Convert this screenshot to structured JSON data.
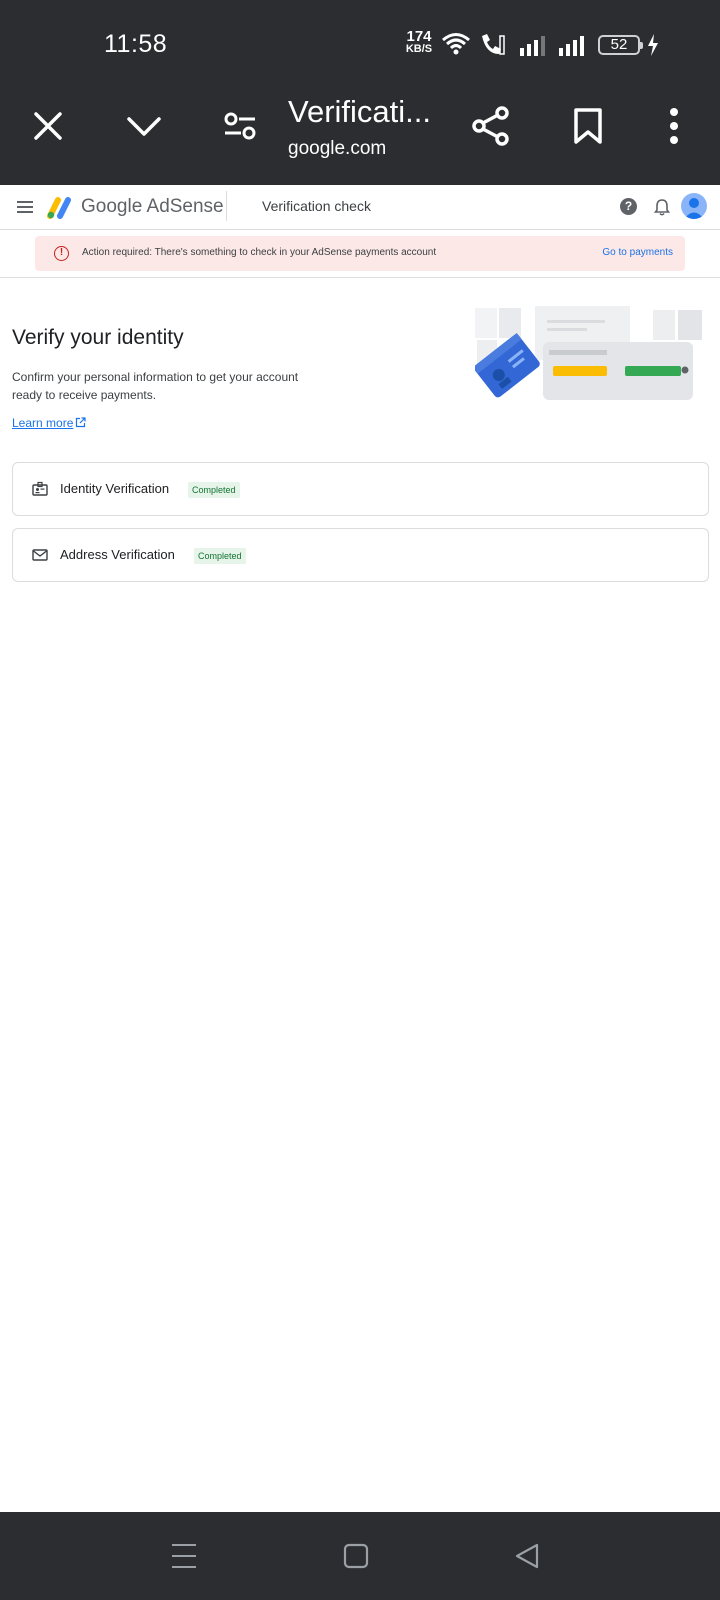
{
  "status_bar": {
    "time": "11:58",
    "net_speed_value": "174",
    "net_speed_unit": "KB/S",
    "battery": "52",
    "icons": [
      "wifi-icon",
      "wifi-calling-icon",
      "signal-icon",
      "signal-icon",
      "charging-icon"
    ]
  },
  "browser": {
    "tab_title": "Verificati...",
    "tab_url": "google.com",
    "icons": [
      "close-icon",
      "chevron-down-icon",
      "tune-icon",
      "share-icon",
      "bookmark-icon",
      "more-vert-icon"
    ]
  },
  "header": {
    "brand_google": "Google",
    "brand_product": "AdSense",
    "page_heading": "Verification check",
    "help_glyph": "?"
  },
  "alert": {
    "icon_glyph": "!",
    "text": "Action required: There's something to check in your AdSense payments account",
    "link": "Go to payments",
    "color": "#fce8e6"
  },
  "main": {
    "title": "Verify your identity",
    "description": "Confirm your personal information to get your account ready to receive payments.",
    "learn_more": "Learn more",
    "items": [
      {
        "label": "Identity Verification",
        "status": "Completed",
        "icon": "id-card-icon"
      },
      {
        "label": "Address Verification",
        "status": "Completed",
        "icon": "mail-icon"
      }
    ]
  },
  "colors": {
    "chrome": "#2b2d30",
    "link": "#1a73e8",
    "badge_bg": "#e6f4ea",
    "badge_text": "#137333"
  }
}
